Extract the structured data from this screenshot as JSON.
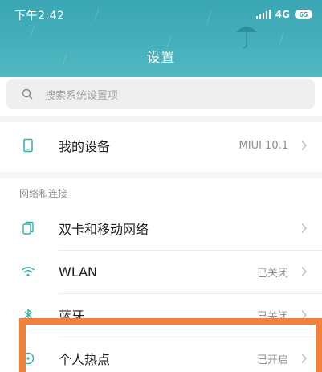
{
  "status_bar": {
    "time": "下午2:42",
    "network": "4G",
    "battery": "65"
  },
  "header": {
    "title": "设置"
  },
  "search": {
    "placeholder": "搜索系统设置项"
  },
  "my_device": {
    "label": "我的设备",
    "value": "MIUI 10.1",
    "icon": "phone-icon"
  },
  "network_section": {
    "header": "网络和连接",
    "items": [
      {
        "label": "双卡和移动网络",
        "value": "",
        "icon": "sim-card-icon"
      },
      {
        "label": "WLAN",
        "value": "已关闭",
        "icon": "wifi-icon"
      },
      {
        "label": "蓝牙",
        "value": "已关闭",
        "icon": "bluetooth-icon"
      },
      {
        "label": "个人热点",
        "value": "已开启",
        "icon": "hotspot-icon"
      }
    ]
  },
  "colors": {
    "header_teal": "#3aa6b3",
    "icon_teal": "#2fb3a6",
    "highlight_orange": "#f4813a"
  }
}
